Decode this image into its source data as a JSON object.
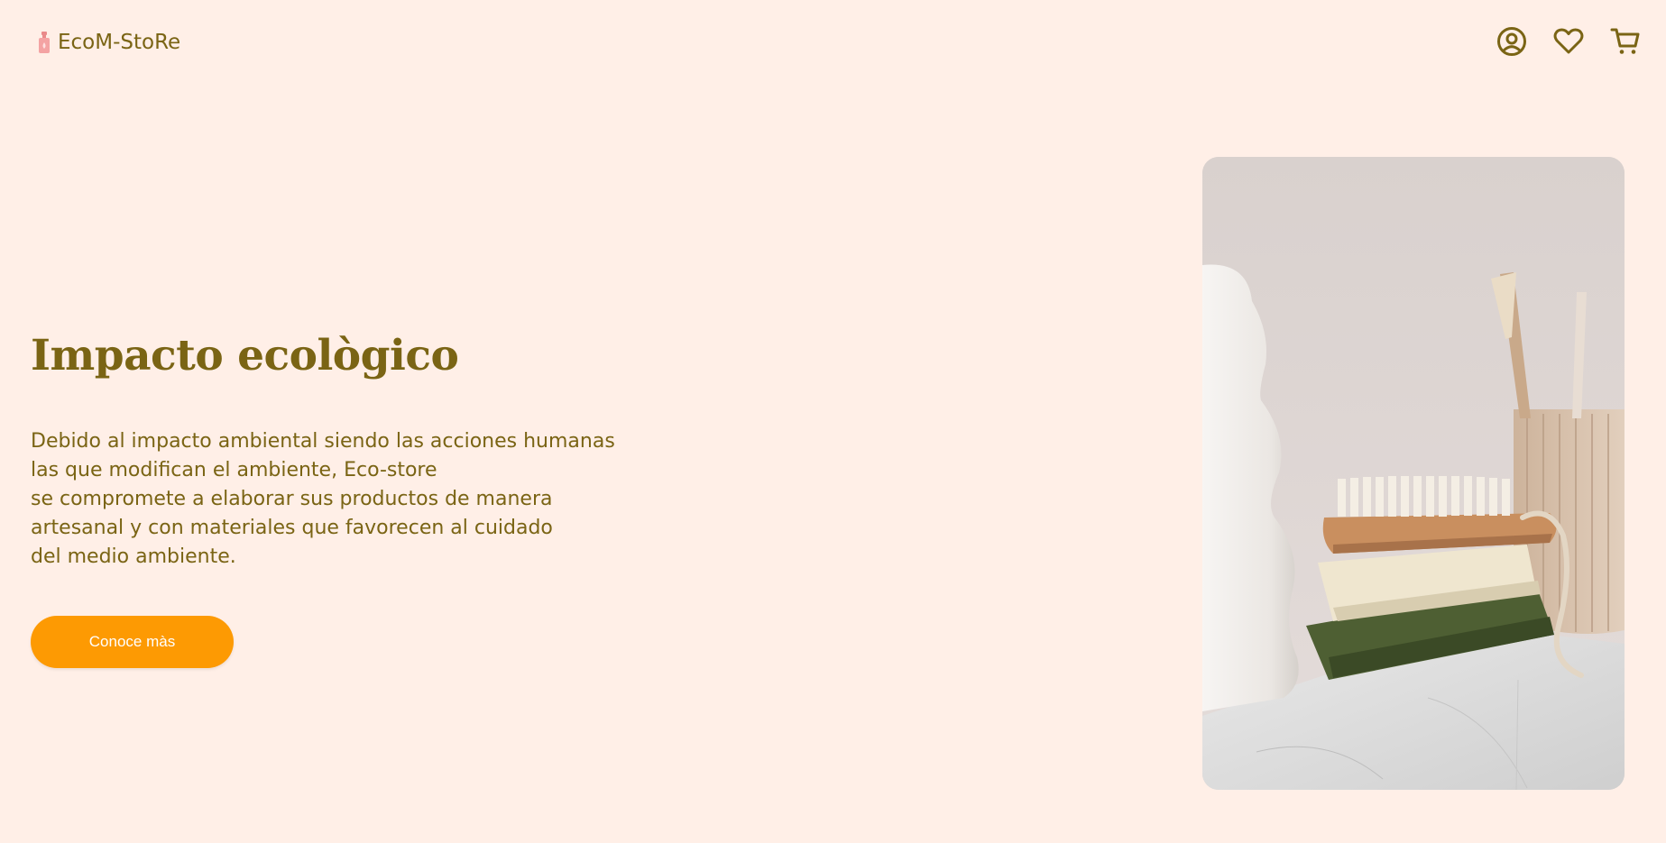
{
  "navbar": {
    "brand": {
      "logo_icon": "lotion-bottle-icon",
      "name": "EcoM-StoRe"
    },
    "icons": [
      "user-circle-icon",
      "heart-icon",
      "cart-icon"
    ]
  },
  "hero": {
    "title": "Impacto ecològico",
    "description_lines": [
      "Debido al impacto ambiental siendo las acciones humanas",
      "las que modifican el ambiente, Eco-store",
      "se compromete a elaborar sus productos de manera",
      "artesanal y con materiales que favorecen al cuidado",
      "del medio ambiente."
    ],
    "button_label": "Conoce màs",
    "image_icon": "soap-and-brush-photo"
  },
  "colors": {
    "background": "#FFEFE7",
    "text": "#7A6414",
    "button": "#FD9A03",
    "button_text": "#FFFFFF"
  }
}
